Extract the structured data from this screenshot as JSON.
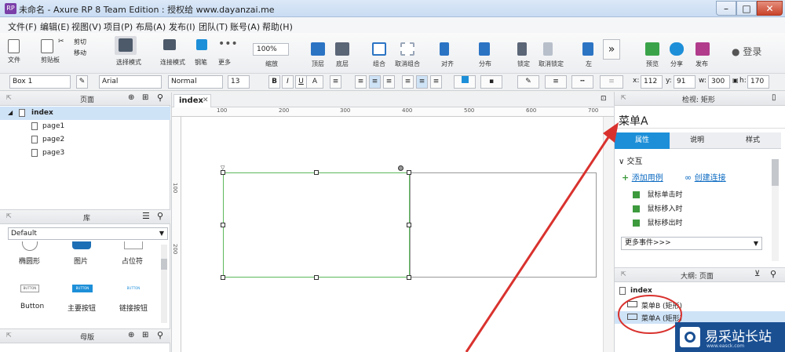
{
  "window": {
    "title": "未命名 - Axure RP 8 Team Edition : 授权给 www.dayanzai.me",
    "app_icon": "RP"
  },
  "menu": [
    "文件(F)",
    "编辑(E)",
    "视图(V)",
    "项目(P)",
    "布局(A)",
    "发布(I)",
    "团队(T)",
    "账号(A)",
    "帮助(H)"
  ],
  "toolbar": {
    "file": "文件",
    "clipboard": "剪贴板",
    "cut": "剪切",
    "move": "移动",
    "select_mode": "选择模式",
    "connect_mode": "连接模式",
    "pen": "钢笔",
    "more": "更多",
    "zoom_value": "100%",
    "zoom_label": "缩放",
    "top": "顶层",
    "bottom": "底层",
    "group": "组合",
    "ungroup": "取消组合",
    "align": "对齐",
    "distribute": "分布",
    "lock": "锁定",
    "unlock": "取消锁定",
    "left": "左",
    "preview": "预览",
    "share": "分享",
    "publish": "发布",
    "login": "登录"
  },
  "format": {
    "widget_name": "Box 1",
    "font": "Arial",
    "style": "Normal",
    "size": "13",
    "x_label": "x:",
    "x": "112",
    "y_label": "y:",
    "y": "91",
    "w_label": "w:",
    "w": "300",
    "h_label": "h:",
    "h": "170"
  },
  "pages_panel": {
    "title": "页面",
    "root": "index",
    "pages": [
      "page1",
      "page2",
      "page3"
    ]
  },
  "library_panel": {
    "title": "库",
    "selected": "Default",
    "widgets": [
      "椭圆形",
      "图片",
      "占位符",
      "Button",
      "主要按钮",
      "链接按钮"
    ],
    "btn_text": "BUTTON"
  },
  "masters_panel": {
    "title": "母版"
  },
  "canvas": {
    "tab": "index",
    "ruler_h": [
      "100",
      "200",
      "300",
      "400",
      "500",
      "600",
      "700"
    ],
    "ruler_v": [
      "100",
      "200"
    ]
  },
  "inspector": {
    "title": "检视: 矩形",
    "widget_name": "菜单A",
    "tabs": [
      "属性",
      "说明",
      "样式"
    ],
    "interaction": "交互",
    "add_case": "添加用例",
    "create_link": "创建连接",
    "events": [
      "鼠标单击时",
      "鼠标移入时",
      "鼠标移出时"
    ],
    "more_events": "更多事件>>>"
  },
  "outline": {
    "title": "大纲: 页面",
    "root": "index",
    "items": [
      "菜单B (矩形)",
      "菜单A (矩形)"
    ]
  },
  "watermark": {
    "text": "易采站长站",
    "sub": "www.easck.com"
  },
  "colors": {
    "selection_green": "#5cb85c",
    "active_tab": "#1d8fd8",
    "annotation_red": "#d9322e"
  }
}
